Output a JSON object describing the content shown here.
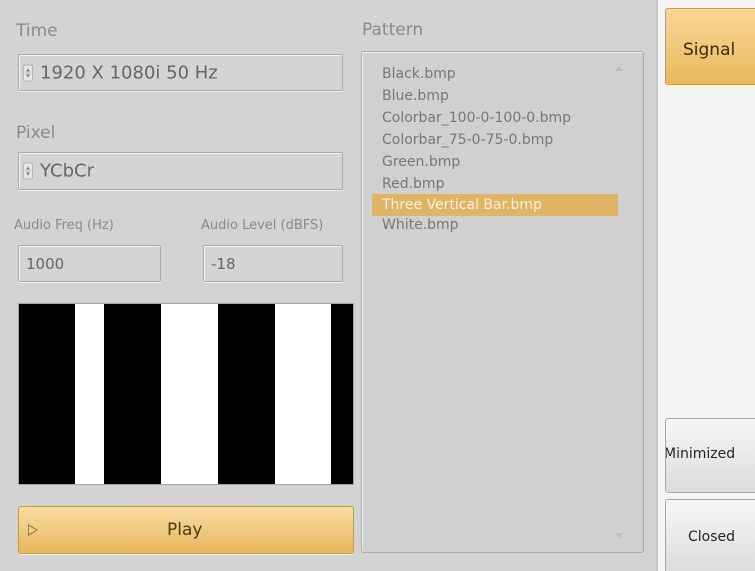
{
  "time": {
    "label": "Time",
    "value": "1920 X 1080i 50 Hz"
  },
  "pixel": {
    "label": "Pixel",
    "value": "YCbCr"
  },
  "audio_freq": {
    "label": "Audio Freq  (Hz)",
    "value": "1000"
  },
  "audio_level": {
    "label": "Audio Level  (dBFS)",
    "value": "-18"
  },
  "preview": {
    "pattern": "Three Vertical Bar",
    "colors": [
      "#000000",
      "#ffffff"
    ]
  },
  "play_button": {
    "label": "Play",
    "icon": "play-triangle-icon"
  },
  "pattern": {
    "label": "Pattern",
    "items": [
      "Black.bmp",
      "Blue.bmp",
      "Colorbar_100-0-100-0.bmp",
      "Colorbar_75-0-75-0.bmp",
      "Green.bmp",
      "Red.bmp",
      "Three Vertical Bar.bmp",
      "White.bmp"
    ],
    "selected_index": 6
  },
  "side_buttons": {
    "signal": "Signal",
    "minimized": "Minimized",
    "closed": "Closed"
  },
  "colors": {
    "accent": "#e7b75c",
    "background": "#d3d3d3",
    "panel": "#f4f4f4"
  }
}
